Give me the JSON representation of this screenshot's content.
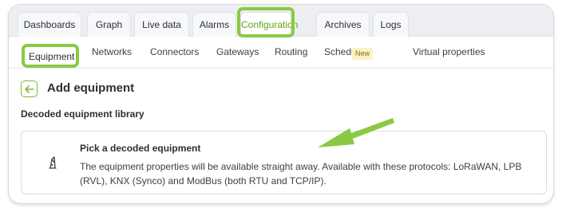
{
  "tabs": [
    {
      "label": "Dashboards",
      "active": false
    },
    {
      "label": "Graph",
      "active": false
    },
    {
      "label": "Live data",
      "active": false
    },
    {
      "label": "Alarms",
      "active": false
    },
    {
      "label": "Configuration",
      "active": true
    },
    {
      "label": "Archives",
      "active": false
    },
    {
      "label": "Logs",
      "active": false
    }
  ],
  "subnav": {
    "items": [
      {
        "label": "Equipment",
        "active": true
      },
      {
        "label": "Networks"
      },
      {
        "label": "Connectors"
      },
      {
        "label": "Gateways"
      },
      {
        "label": "Routing"
      },
      {
        "label": "Scheduling",
        "badge": "New"
      },
      {
        "label": "Virtual properties"
      }
    ]
  },
  "page": {
    "title": "Add equipment",
    "section_label": "Decoded equipment library"
  },
  "card": {
    "title": "Pick a decoded equipment",
    "description": "The equipment properties will be available straight away. Available with these protocols: LoRaWAN, LPB (RVL), KNX (Synco) and ModBus (both RTU and TCP/IP).",
    "icon": "decoded-equipment-icon"
  },
  "colors": {
    "accent": "#5ea51a",
    "highlight": "#8bc944",
    "badge_bg": "#fbf1c8"
  }
}
